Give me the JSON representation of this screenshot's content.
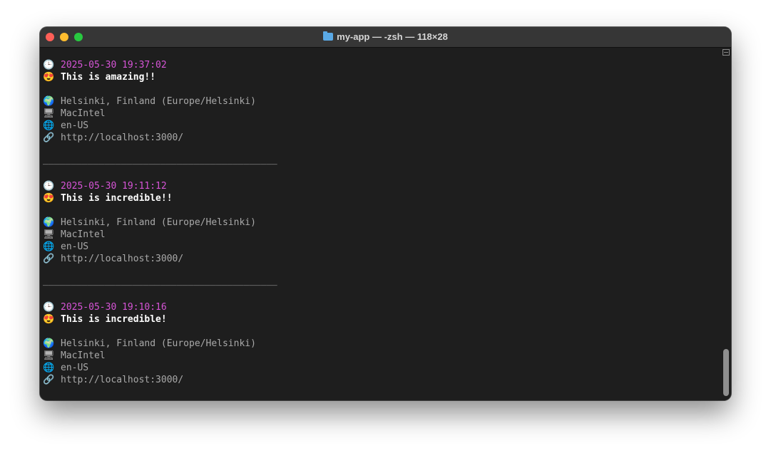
{
  "window": {
    "title": "my-app — -zsh — 118×28"
  },
  "terminal": {
    "entries": [
      {
        "clock_icon": "🕒",
        "timestamp": "2025-05-30 19:37:02",
        "face_icon": "😍",
        "message": "This is amazing!!",
        "globe_icon": "🌍",
        "location": "Helsinki, Finland (Europe/Helsinki)",
        "computer_icon": "🖥",
        "platform": "MacIntel",
        "lang_icon": "🌐",
        "language": "en-US",
        "link_icon": "🔗",
        "url": "http://localhost:3000/"
      },
      {
        "clock_icon": "🕒",
        "timestamp": "2025-05-30 19:11:12",
        "face_icon": "😍",
        "message": "This is incredible!!",
        "globe_icon": "🌍",
        "location": "Helsinki, Finland (Europe/Helsinki)",
        "computer_icon": "🖥",
        "platform": "MacIntel",
        "lang_icon": "🌐",
        "language": "en-US",
        "link_icon": "🔗",
        "url": "http://localhost:3000/"
      },
      {
        "clock_icon": "🕒",
        "timestamp": "2025-05-30 19:10:16",
        "face_icon": "😍",
        "message": "This is incredible!",
        "globe_icon": "🌍",
        "location": "Helsinki, Finland (Europe/Helsinki)",
        "computer_icon": "🖥",
        "platform": "MacIntel",
        "lang_icon": "🌐",
        "language": "en-US",
        "link_icon": "🔗",
        "url": "http://localhost:3000/"
      }
    ],
    "separator": "__________________________________________"
  },
  "colors": {
    "timestamp": "#d654d6",
    "message": "#ffffff",
    "info": "#a9a9a9",
    "background": "#1e1e1e"
  }
}
